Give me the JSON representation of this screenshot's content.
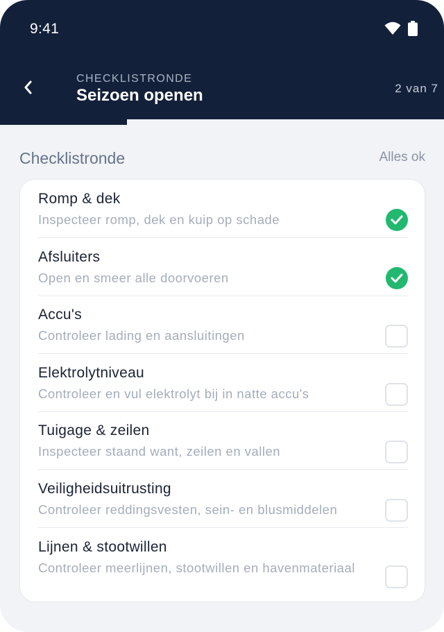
{
  "status": {
    "time": "9:41"
  },
  "header": {
    "kicker": "CHECKLISTRONDE",
    "title": "Seizoen openen",
    "step": "2 van 7",
    "progress": 0.2857
  },
  "section": {
    "title": "Checklistronde",
    "action": "Alles ok"
  },
  "items": [
    {
      "label": "Romp & dek",
      "desc": "Inspecteer romp, dek en kuip op schade",
      "checked": true
    },
    {
      "label": "Afsluiters",
      "desc": "Open en smeer alle doorvoeren",
      "checked": true
    },
    {
      "label": "Accu's",
      "desc": "Controleer lading en aansluitingen",
      "checked": false
    },
    {
      "label": "Elektrolytniveau",
      "desc": "Controleer en vul elektrolyt bij in natte accu's",
      "checked": false
    },
    {
      "label": "Tuigage & zeilen",
      "desc": "Inspecteer staand want, zeilen en vallen",
      "checked": false
    },
    {
      "label": "Veiligheidsuitrusting",
      "desc": "Controleer reddingsvesten, sein- en blusmiddelen",
      "checked": false
    },
    {
      "label": "Lijnen & stootwillen",
      "desc": "Controleer meerlijnen, stootwillen en havenmateriaal",
      "checked": false
    }
  ],
  "colors": {
    "header": "#13203a",
    "accent_check": "#22b870"
  }
}
